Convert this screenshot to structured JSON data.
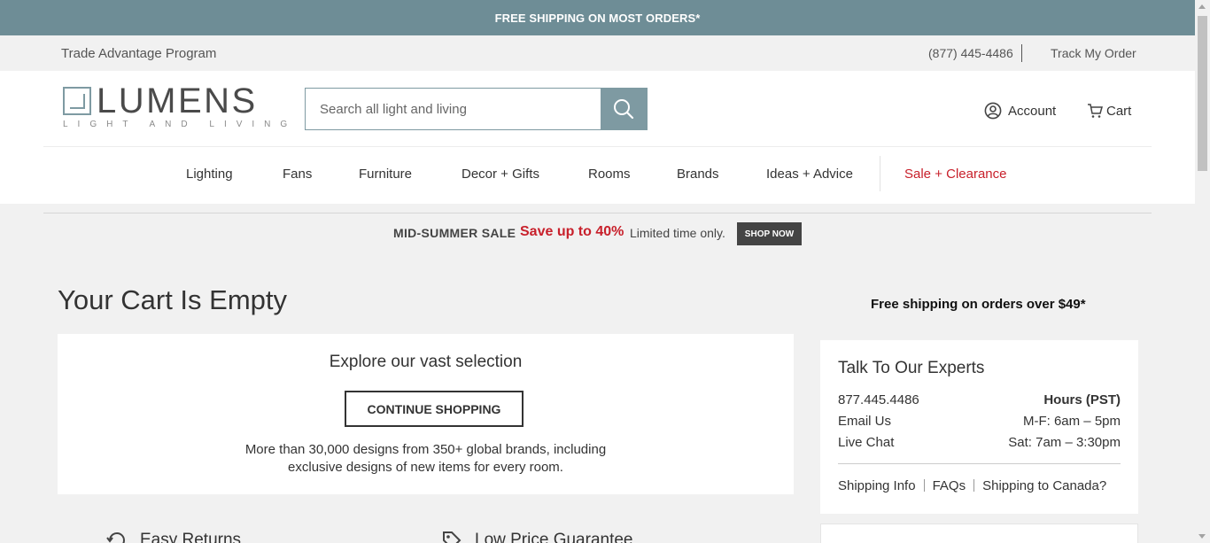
{
  "promo": {
    "text": "FREE SHIPPING ON MOST ORDERS*"
  },
  "utility": {
    "trade": "Trade Advantage Program",
    "phone": "(877) 445-4486",
    "track": "Track My Order"
  },
  "logo": {
    "word": "LUMENS",
    "tagline": "LIGHT AND LIVING"
  },
  "search": {
    "placeholder": "Search all light and living",
    "icon": "search-icon"
  },
  "header": {
    "account": "Account",
    "cart": "Cart"
  },
  "nav": {
    "items": [
      "Lighting",
      "Fans",
      "Furniture",
      "Decor + Gifts",
      "Rooms",
      "Brands",
      "Ideas + Advice"
    ],
    "sale": "Sale + Clearance"
  },
  "sale_banner": {
    "label": "MID-SUMMER SALE",
    "offer": "Save up to 40%",
    "note": "Limited time only.",
    "cta": "SHOP NOW"
  },
  "cart": {
    "title": "Your Cart Is Empty",
    "free_shipping": "Free shipping on orders over $49*"
  },
  "explore": {
    "heading": "Explore our vast selection",
    "button": "CONTINUE SHOPPING",
    "desc_line1": "More than 30,000 designs from 350+ global brands, including",
    "desc_line2": "exclusive designs of new items for every room."
  },
  "experts": {
    "title": "Talk To Our Experts",
    "phone": "877.445.4486",
    "hours_label": "Hours (PST)",
    "email": "Email Us",
    "weekday_hours": "M-F: 6am – 5pm",
    "chat": "Live Chat",
    "sat_hours": "Sat: 7am – 3:30pm",
    "links": [
      "Shipping Info",
      "FAQs",
      "Shipping to Canada?"
    ]
  },
  "features": [
    "Easy Returns",
    "Low Price Guarantee"
  ],
  "colors": {
    "brand": "#6e8d96",
    "sale": "#c8202b",
    "dark": "#444444"
  }
}
